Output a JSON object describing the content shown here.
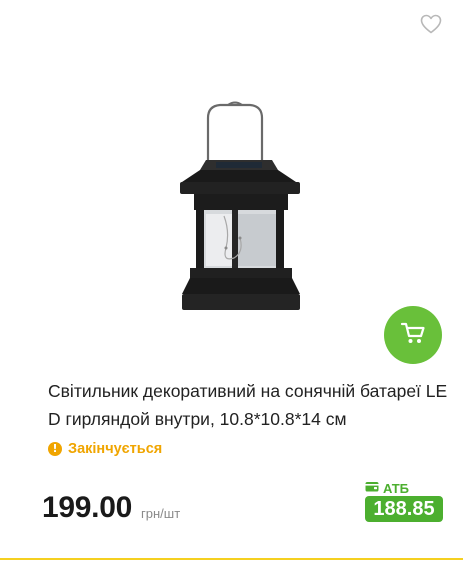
{
  "product": {
    "title": "Світильник декоративний на сонячній батареї LED гирляндой внутри, 10.8*10.8*14 см",
    "status": "Закінчується",
    "price": "199.00",
    "unit": "грн/шт",
    "card_label": "АТБ",
    "card_price": "188.85"
  },
  "icons": {
    "favorite": "heart-outline-icon",
    "cart": "cart-icon",
    "status": "exclamation-circle-icon",
    "card": "wallet-icon"
  },
  "colors": {
    "accent_green": "#69c03a",
    "card_price_green": "#4caf2f",
    "status_orange": "#f0a500",
    "divider_yellow": "#f5d020"
  }
}
